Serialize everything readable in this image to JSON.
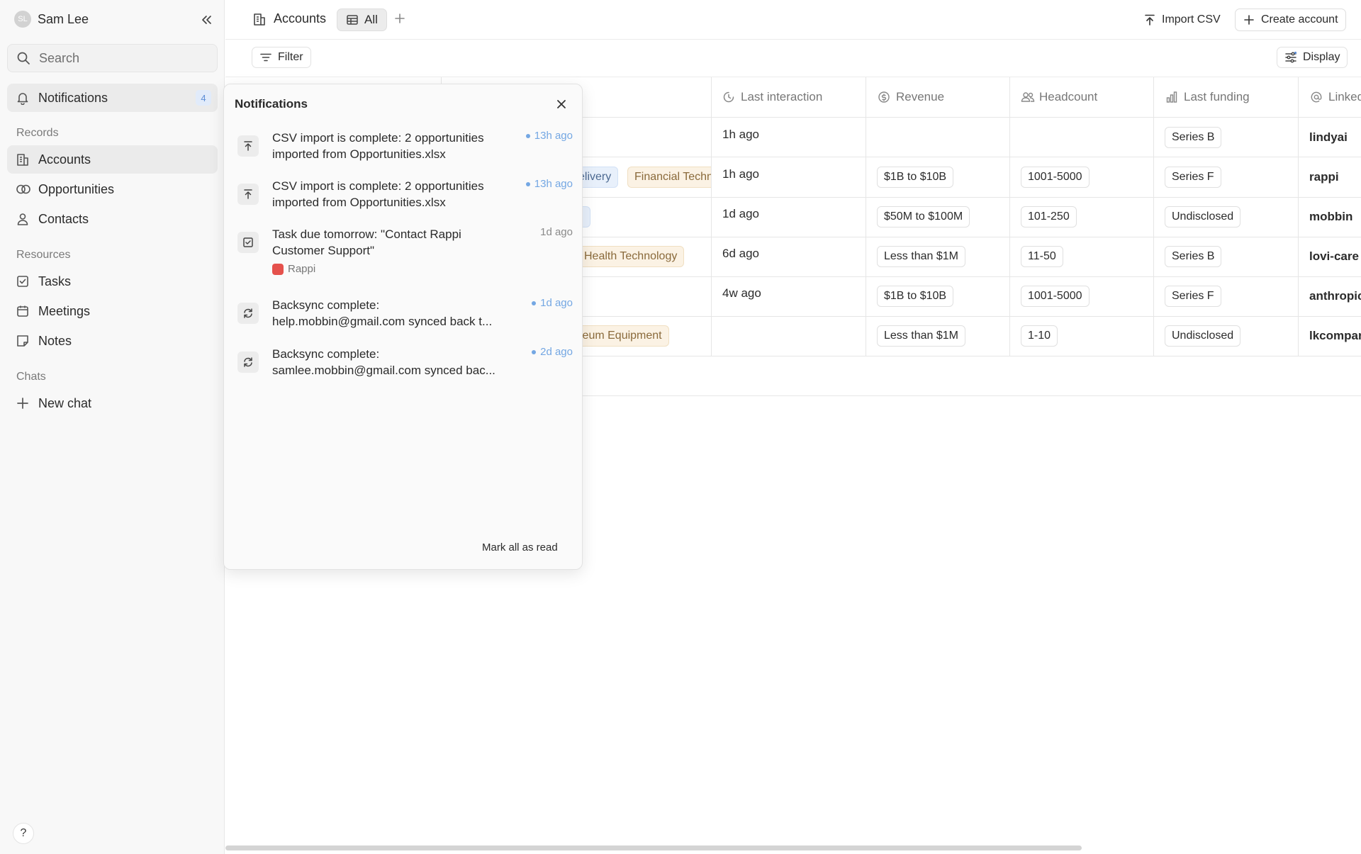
{
  "user": {
    "initials": "SL",
    "name": "Sam Lee"
  },
  "search": {
    "label": "Search"
  },
  "notifications_nav": {
    "label": "Notifications",
    "count": "4"
  },
  "sidebar": {
    "records_label": "Records",
    "records": [
      {
        "label": "Accounts",
        "icon": "building-icon",
        "active": true
      },
      {
        "label": "Opportunities",
        "icon": "rings-icon"
      },
      {
        "label": "Contacts",
        "icon": "person-icon"
      }
    ],
    "resources_label": "Resources",
    "resources": [
      {
        "label": "Tasks",
        "icon": "checkbox-icon"
      },
      {
        "label": "Meetings",
        "icon": "calendar-icon"
      },
      {
        "label": "Notes",
        "icon": "note-icon"
      }
    ],
    "chats_label": "Chats",
    "new_chat": "New chat",
    "help": "?"
  },
  "topbar": {
    "object": "Accounts",
    "view": "All",
    "import": "Import CSV",
    "create": "Create account"
  },
  "toolbar": {
    "filter": "Filter",
    "display": "Display"
  },
  "table": {
    "columns": [
      {
        "label": "Last interaction",
        "icon": "clock-icon"
      },
      {
        "label": "Revenue",
        "icon": "dollar-icon"
      },
      {
        "label": "Headcount",
        "icon": "people-icon"
      },
      {
        "label": "Last funding",
        "icon": "bar-chart-icon"
      },
      {
        "label": "Linked",
        "icon": "at-icon"
      }
    ],
    "rows": [
      {
        "last_interaction": "1h ago",
        "revenue": "",
        "headcount": "",
        "funding": "Series B",
        "linked": "lindyai"
      },
      {
        "last_interaction": "1h ago",
        "revenue": "$1B to $10B",
        "headcount": "1001-5000",
        "funding": "Series F",
        "linked": "rappi"
      },
      {
        "last_interaction": "1d ago",
        "revenue": "$50M to $100M",
        "headcount": "101-250",
        "funding": "Undisclosed",
        "linked": "mobbin"
      },
      {
        "last_interaction": "6d ago",
        "revenue": "Less than $1M",
        "headcount": "11-50",
        "funding": "Series B",
        "linked": "lovi-care"
      },
      {
        "last_interaction": "4w ago",
        "revenue": "$1B to $10B",
        "headcount": "1001-5000",
        "funding": "Series F",
        "linked": "anthropic"
      },
      {
        "last_interaction": "",
        "revenue": "Less than $1M",
        "headcount": "1-10",
        "funding": "Undisclosed",
        "linked": "lkcompan"
      }
    ],
    "partial_tags": {
      "delivery": "elivery",
      "fintech": "Financial Techn",
      "health": "Health Technology",
      "equipment": "leum Equipment"
    }
  },
  "panel": {
    "title": "Notifications",
    "items": [
      {
        "icon": "upload-icon",
        "text": "CSV import is complete: 2 opportunities imported from Opportunities.xlsx",
        "time": "13h ago",
        "unread": true
      },
      {
        "icon": "upload-icon",
        "text": "CSV import is complete: 2 opportunities imported from Opportunities.xlsx",
        "time": "13h ago",
        "unread": true
      },
      {
        "icon": "checkbox-icon",
        "text": "Task due tomorrow: \"Contact Rappi Customer Support\"",
        "time": "1d ago",
        "unread": false,
        "sub": "Rappi"
      },
      {
        "icon": "sync-icon",
        "text": "Backsync complete: help.mobbin@gmail.com synced back t...",
        "time": "1d ago",
        "unread": true
      },
      {
        "icon": "sync-icon",
        "text": "Backsync complete: samlee.mobbin@gmail.com synced bac...",
        "time": "2d ago",
        "unread": true
      }
    ],
    "mark_all": "Mark all as read"
  }
}
